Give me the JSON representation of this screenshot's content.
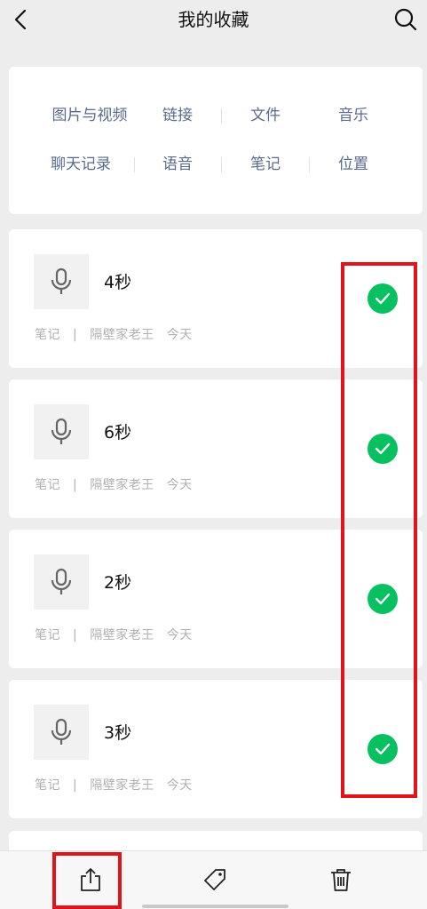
{
  "header": {
    "title": "我的收藏",
    "back_icon": "chevron-left-icon",
    "search_icon": "search-icon"
  },
  "categories": {
    "row1": [
      "图片与视频",
      "链接",
      "文件",
      "音乐"
    ],
    "row2": [
      "聊天记录",
      "语音",
      "笔记",
      "位置"
    ]
  },
  "items": [
    {
      "duration": "4秒",
      "type": "笔记",
      "separator": "|",
      "author": "隔壁家老王",
      "time": "今天",
      "selected": true
    },
    {
      "duration": "6秒",
      "type": "笔记",
      "separator": "|",
      "author": "隔壁家老王",
      "time": "今天",
      "selected": true
    },
    {
      "duration": "2秒",
      "type": "笔记",
      "separator": "|",
      "author": "隔壁家老王",
      "time": "今天",
      "selected": true
    },
    {
      "duration": "3秒",
      "type": "笔记",
      "separator": "|",
      "author": "隔壁家老王",
      "time": "今天",
      "selected": true
    }
  ],
  "toolbar": {
    "share_icon": "share-icon",
    "tag_icon": "tag-icon",
    "delete_icon": "trash-icon"
  },
  "colors": {
    "accent_green": "#07c160",
    "highlight_red": "#e1141c",
    "category_text": "#5a6a8c"
  }
}
